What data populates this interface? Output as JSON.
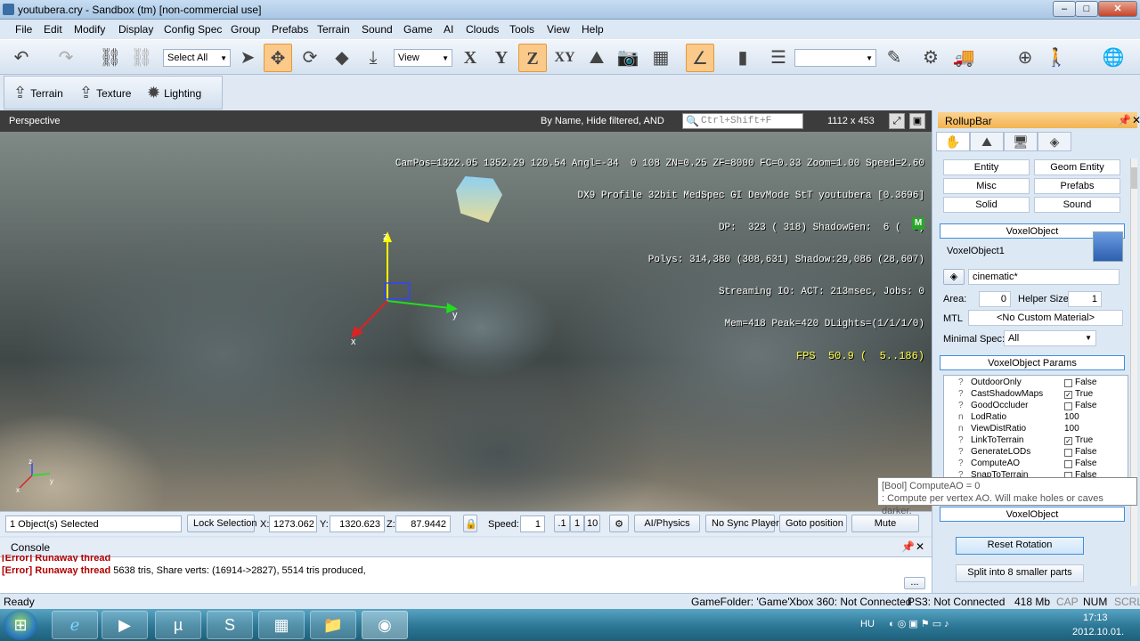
{
  "window": {
    "title": "youtubera.cry - Sandbox (tm) [non-commercial use]"
  },
  "menu": [
    "File",
    "Edit",
    "Modify",
    "Display",
    "Config Spec",
    "Group",
    "Prefabs",
    "Terrain",
    "Sound",
    "Game",
    "AI",
    "Clouds",
    "Tools",
    "View",
    "Help"
  ],
  "toolbar": {
    "select_value": "Select All",
    "view_value": "View",
    "axis_labels": [
      "X",
      "Y",
      "Z",
      "XY"
    ]
  },
  "toolbar2": {
    "terrain": "Terrain",
    "texture": "Texture",
    "lighting": "Lighting"
  },
  "viewport": {
    "label": "Perspective",
    "filter": "By Name, Hide filtered, AND",
    "search_placeholder": "Ctrl+Shift+F",
    "size": "1112 x 453",
    "hud_lines": [
      "CamPos=1322.05 1352.29 120.54 Angl=-34  0 108 ZN=0.25 ZF=8000 FC=0.33 Zoom=1.00 Speed=2.60",
      "DX9 Profile 32bit MedSpec GI DevMode StT youtubera [0.3696]",
      "DP:  323 ( 318) ShadowGen:  6 (  6)",
      "Polys: 314,380 (308,631) Shadow:29,086 (28,607)",
      "Streaming IO: ACT: 213msec, Jobs: 0",
      "Mem=418 Peak=420 DLights=(1/1/1/0)"
    ],
    "fps": "FPS  50.9 (  5..186)",
    "gizmo": {
      "x": "x",
      "y": "y",
      "z": "z"
    },
    "mini_axes": {
      "x": "x",
      "y": "y",
      "z": "z"
    },
    "badge": "M"
  },
  "status_row": {
    "selected": "1 Object(s) Selected",
    "lock_selection": "Lock Selection",
    "x_label": "X:",
    "x_value": "1273.062",
    "y_label": "Y:",
    "y_value": "1320.623",
    "z_label": "Z:",
    "z_value": "87.9442",
    "speed_label": "Speed:",
    "speed_value": "1",
    "speed_presets": [
      ".1",
      "1",
      "10"
    ],
    "ai_physics": "AI/Physics",
    "no_sync": "No Sync Player",
    "goto": "Goto position",
    "mute": "Mute"
  },
  "console": {
    "title": "Console",
    "line1": "[Error] Runaway thread",
    "line2_err": "[Error] Runaway thread",
    "line2_rest": " 5638 tris,  Share verts: (16914->2827), 5514 tris produced,",
    "more": "..."
  },
  "status_bar": {
    "ready": "Ready",
    "gamefolder": "GameFolder: 'Game'",
    "xbox": "Xbox 360: Not Connected",
    "ps3": "PS3: Not Connected",
    "mem": "418 Mb",
    "cap": "CAP",
    "num": "NUM",
    "scrl": "SCRL"
  },
  "rollup": {
    "title": "RollupBar",
    "buttons": [
      "Entity",
      "Geom Entity",
      "Misc",
      "Prefabs",
      "Solid",
      "Sound"
    ],
    "section1": "VoxelObject",
    "object_name": "VoxelObject1",
    "layer": "cinematic*",
    "area_label": "Area:",
    "area_value": "0",
    "helper_label": "Helper Size:",
    "helper_value": "1",
    "mtl_label": "MTL",
    "mtl_value": "<No Custom Material>",
    "minspec_label": "Minimal Spec:",
    "minspec_value": "All",
    "section2": "VoxelObject Params",
    "params": [
      {
        "q": "?",
        "name": "OutdoorOnly",
        "check": "",
        "value": "False"
      },
      {
        "q": "?",
        "name": "CastShadowMaps",
        "check": "✓",
        "value": "True"
      },
      {
        "q": "?",
        "name": "GoodOccluder",
        "check": "",
        "value": "False"
      },
      {
        "q": "n",
        "name": "LodRatio",
        "check": null,
        "value": "100"
      },
      {
        "q": "n",
        "name": "ViewDistRatio",
        "check": null,
        "value": "100"
      },
      {
        "q": "?",
        "name": "LinkToTerrain",
        "check": "✓",
        "value": "True"
      },
      {
        "q": "?",
        "name": "GenerateLODs",
        "check": "",
        "value": "False"
      },
      {
        "q": "?",
        "name": "ComputeAO",
        "check": "",
        "value": "False"
      },
      {
        "q": "?",
        "name": "SnapToTerrain",
        "check": "",
        "value": "False"
      }
    ],
    "section3": "VoxelObject",
    "reset_rotation": "Reset Rotation",
    "split": "Split into 8 smaller parts"
  },
  "tooltip": {
    "line1": "[Bool] ComputeAO = 0",
    "line2": ": Compute per vertex AO. Will make holes or caves darker."
  },
  "taskbar": {
    "lang": "HU",
    "time": "17:13",
    "date": "2012.10.01."
  }
}
